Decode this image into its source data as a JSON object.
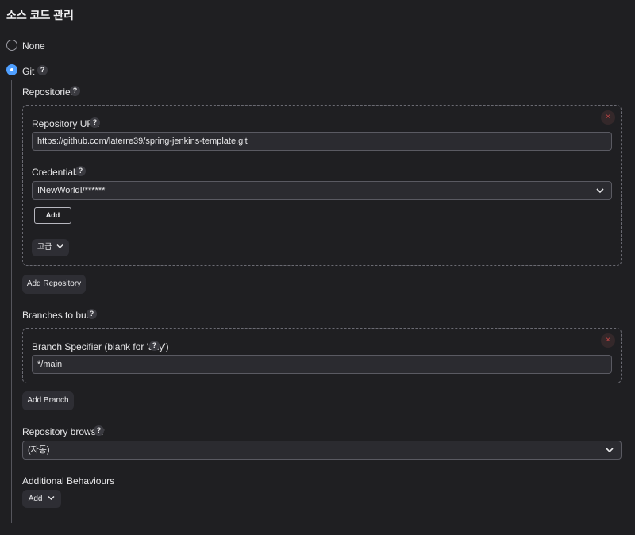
{
  "section": {
    "title": "소스 코드 관리"
  },
  "scm_options": [
    {
      "label": "None",
      "selected": false
    },
    {
      "label": "Git",
      "selected": true,
      "help": "?"
    }
  ],
  "git": {
    "repositories_label": "Repositories",
    "help": "?",
    "repository": {
      "remove_symbol": "×",
      "url_label": "Repository URL",
      "url_value": "https://github.com/laterre39/spring-jenkins-template.git",
      "credentials_label": "Credentials",
      "credentials_value": "INewWorldI/******",
      "add_label": "Add",
      "advanced_label": "고급"
    },
    "add_repository_label": "Add Repository",
    "branches_label": "Branches to build",
    "branch": {
      "remove_symbol": "×",
      "specifier_label": "Branch Specifier (blank for 'any')",
      "specifier_value": "*/main"
    },
    "add_branch_label": "Add Branch",
    "browser_label": "Repository browser",
    "browser_value": "(자동)",
    "additional_label": "Additional Behaviours",
    "additional_add_label": "Add"
  },
  "colors": {
    "background": "#1f1f22",
    "accent": "#4f9fff",
    "danger": "#d04848",
    "field_bg": "#2b2b30"
  }
}
